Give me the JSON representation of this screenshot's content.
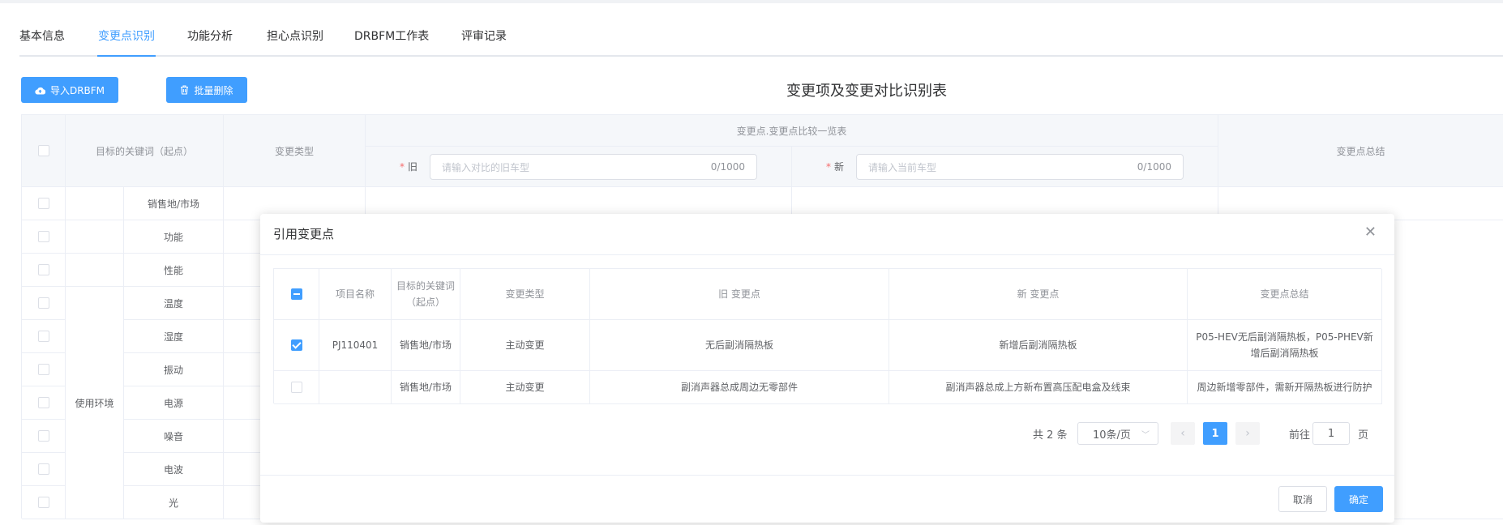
{
  "tabs": [
    "基本信息",
    "变更点识别",
    "功能分析",
    "担心点识别",
    "DRBFM工作表",
    "评审记录"
  ],
  "toolbar": {
    "import_label": "导入DRBFM",
    "batch_delete_label": "批量删除"
  },
  "page_title": "变更项及变更对比识别表",
  "table": {
    "headers": {
      "keyword": "目标的关键词（起点）",
      "change_type": "变更类型",
      "compare": "变更点.变更点比较一览表",
      "summary": "变更点总结"
    },
    "old_label": "旧",
    "new_label": "新",
    "old_placeholder": "请输入对比的旧车型",
    "new_placeholder": "请输入当前车型",
    "old_counter": "0/1000",
    "new_counter": "0/1000",
    "group_label": "使用环境",
    "rows": [
      "销售地/市场",
      "功能",
      "性能",
      "温度",
      "湿度",
      "振动",
      "电源",
      "噪音",
      "电波",
      "光"
    ]
  },
  "dialog": {
    "title": "引用变更点",
    "columns": [
      "项目名称",
      "目标的关键词（起点）",
      "变更类型",
      "旧 变更点",
      "新 变更点",
      "变更点总结"
    ],
    "rows": [
      {
        "checked": true,
        "project": "PJ110401",
        "keyword": "销售地/市场",
        "type": "主动变更",
        "old": "无后副消隔热板",
        "new": "新增后副消隔热板",
        "summary": "P05-HEV无后副消隔热板，P05-PHEV新增后副消隔热板"
      },
      {
        "checked": false,
        "project": "",
        "keyword": "销售地/市场",
        "type": "主动变更",
        "old": "副消声器总成周边无零部件",
        "new": "副消声器总成上方新布置高压配电盒及线束",
        "summary": "周边新增零部件，需新开隔热板进行防护"
      }
    ],
    "pagination": {
      "total": "共 2 条",
      "page_size": "10条/页",
      "current_page": "1",
      "goto_prefix": "前往",
      "goto_value": "1",
      "goto_suffix": "页"
    },
    "cancel_label": "取消",
    "confirm_label": "确定"
  },
  "colors": {
    "primary": "#409eff",
    "required": "#f56c6c",
    "border": "#ebeef5",
    "header_bg": "#f5f7fa"
  }
}
